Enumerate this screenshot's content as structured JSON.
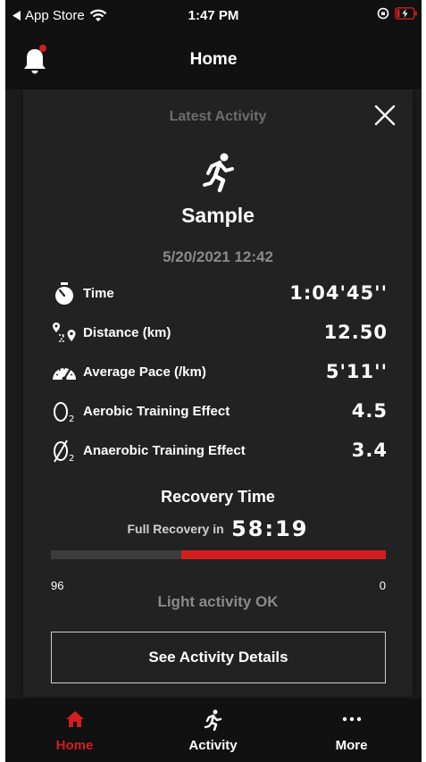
{
  "status_bar": {
    "back_app": "App Store",
    "time": "1:47 PM"
  },
  "header": {
    "title": "Home",
    "notification_dot": true
  },
  "card": {
    "title": "Latest Activity",
    "activity_name": "Sample",
    "date": "5/20/2021 12:42",
    "metrics": [
      {
        "icon": "stopwatch-icon",
        "label": "Time",
        "value": "1:04'45''"
      },
      {
        "icon": "distance-pins-icon",
        "label": "Distance (km)",
        "value": "12.50"
      },
      {
        "icon": "speedometer-icon",
        "label": "Average Pace (/km)",
        "value": "5'11''"
      },
      {
        "icon": "o2-icon",
        "label": "Aerobic Training Effect",
        "value": "4.5"
      },
      {
        "icon": "o2-slash-icon",
        "label": "Anaerobic Training Effect",
        "value": "3.4"
      }
    ],
    "recovery": {
      "title": "Recovery Time",
      "label": "Full Recovery in",
      "time": "58:19",
      "bar_max": "96",
      "bar_min": "0",
      "remaining_fraction": 0.61,
      "status": "Light activity OK"
    },
    "details_button": "See Activity Details"
  },
  "tabs": [
    {
      "label": "Home",
      "icon": "house-icon",
      "active": true
    },
    {
      "label": "Activity",
      "icon": "runner-icon",
      "active": false
    },
    {
      "label": "More",
      "icon": "more-dots-icon",
      "active": false
    }
  ],
  "colors": {
    "accent": "#d21e1e",
    "background": "#1c1c1c",
    "card": "#222222"
  }
}
